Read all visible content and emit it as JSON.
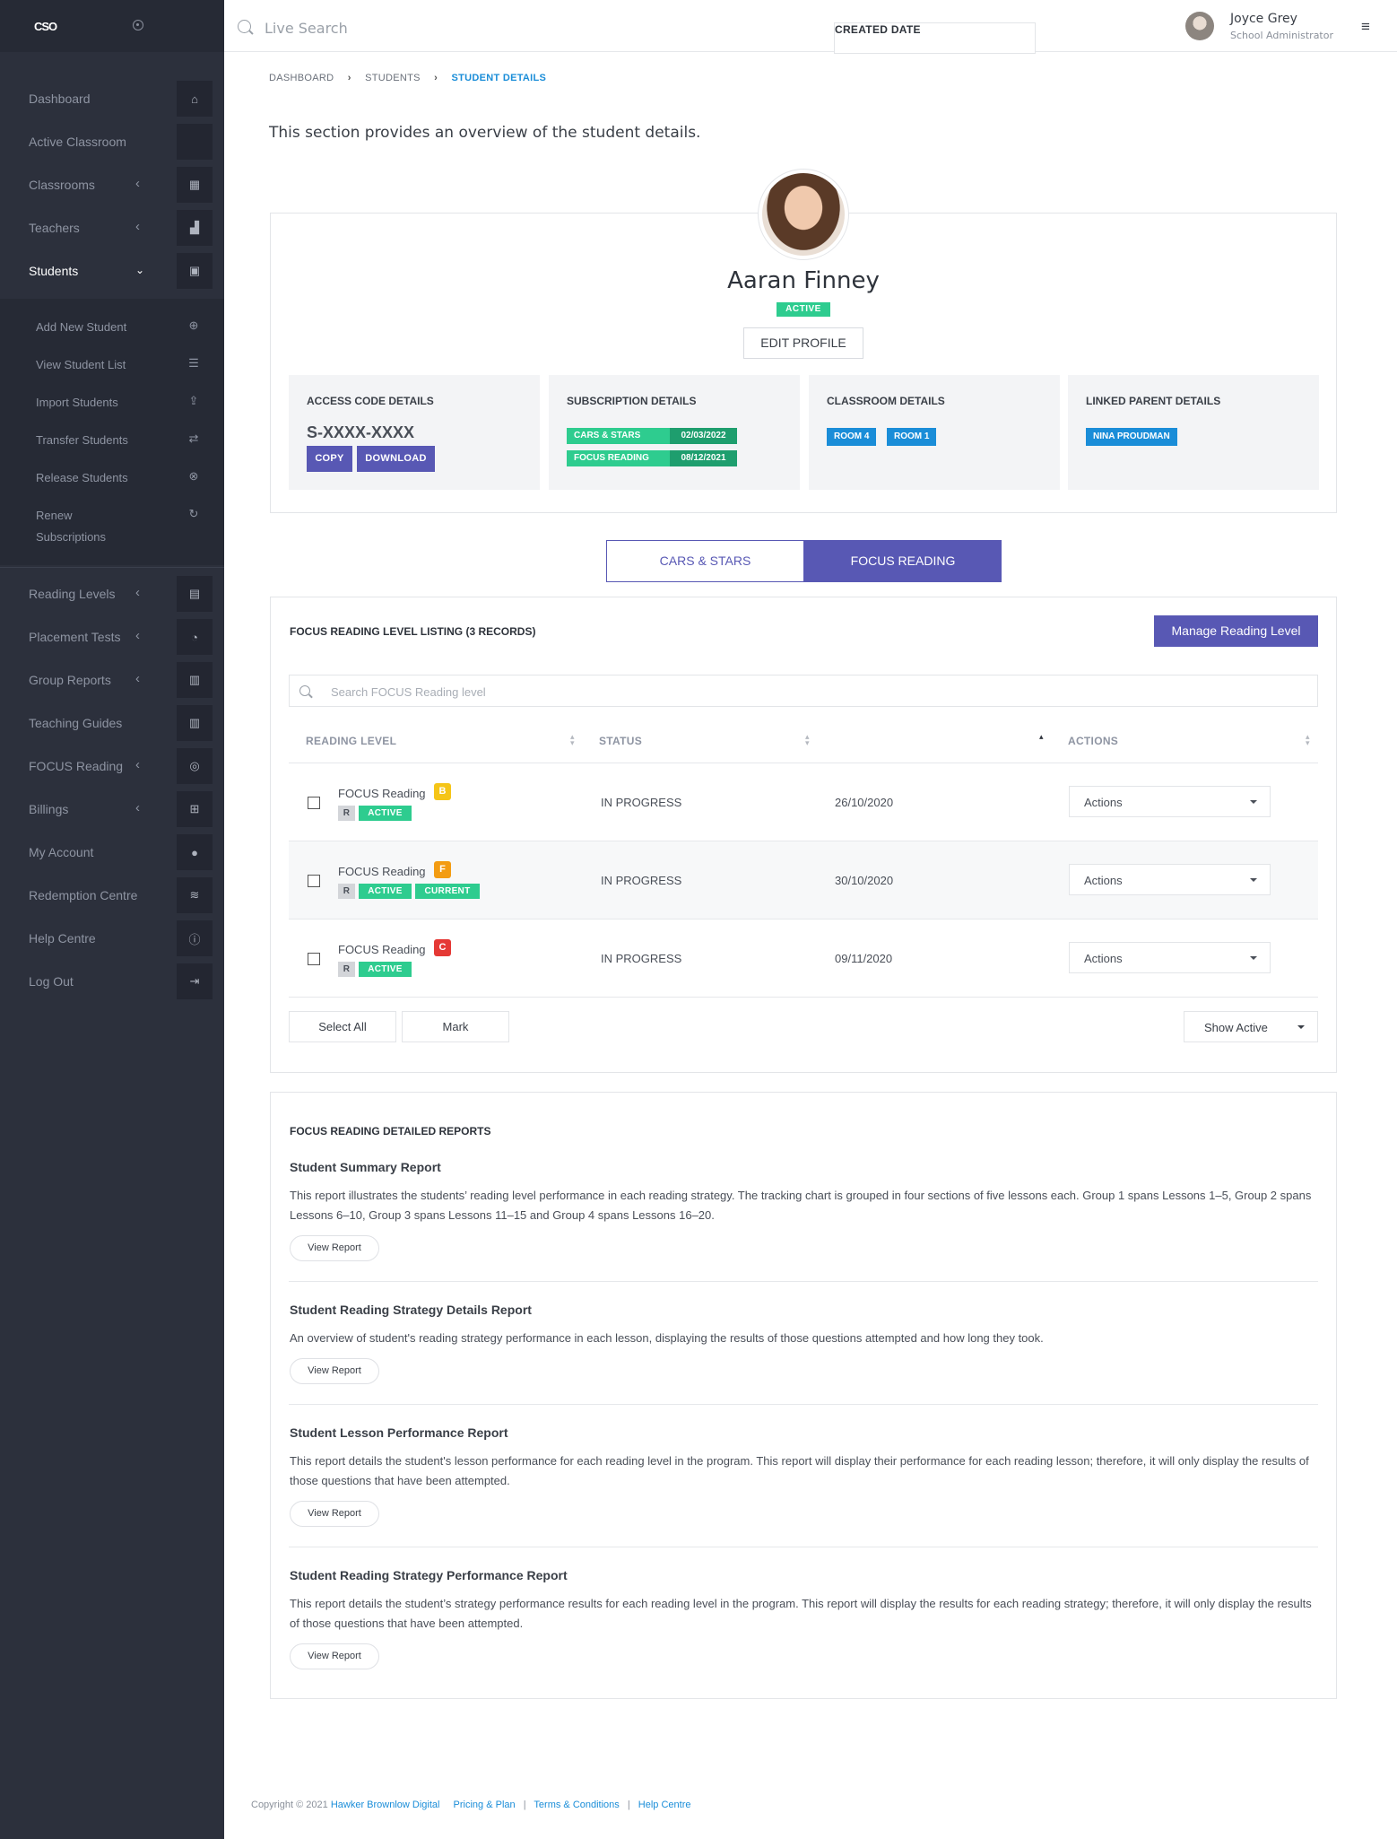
{
  "sidebar": {
    "logo": "CSO",
    "nav": [
      {
        "label": "Dashboard",
        "icon": "home-icon",
        "glyph": "⌂"
      },
      {
        "label": "Active Classroom",
        "icon": "blank-icon",
        "glyph": ""
      },
      {
        "label": "Classrooms",
        "icon": "classroom-icon",
        "glyph": "▦"
      },
      {
        "label": "Teachers",
        "icon": "teacher-icon",
        "glyph": "▟"
      },
      {
        "label": "Students",
        "icon": "student-icon",
        "glyph": "▣"
      }
    ],
    "sub": [
      {
        "label": "Add New Student",
        "icon": "plus-circle-icon",
        "glyph": "⊕"
      },
      {
        "label": "View Student List",
        "icon": "list-icon",
        "glyph": "☰"
      },
      {
        "label": "Import Students",
        "icon": "upload-icon",
        "glyph": "⇪"
      },
      {
        "label": "Transfer Students",
        "icon": "transfer-icon",
        "glyph": "⇄"
      },
      {
        "label": "Release Students",
        "icon": "user-remove-icon",
        "glyph": "⊗"
      },
      {
        "label": "Renew",
        "label2": "Subscriptions",
        "icon": "renew-icon",
        "glyph": "↻"
      }
    ],
    "nav2": [
      {
        "label": "Reading Levels",
        "icon": "book-icon",
        "glyph": "▤"
      },
      {
        "label": "Placement Tests",
        "icon": "gauge-icon",
        "glyph": "◔"
      },
      {
        "label": "Group Reports",
        "icon": "chart-icon",
        "glyph": "▥"
      },
      {
        "label": "Teaching Guides",
        "icon": "library-icon",
        "glyph": "▥"
      },
      {
        "label": "FOCUS Reading",
        "icon": "target-icon",
        "glyph": "◎"
      },
      {
        "label": "Billings",
        "icon": "cart-icon",
        "glyph": "⊞"
      },
      {
        "label": "My Account",
        "icon": "account-icon",
        "glyph": "●"
      },
      {
        "label": "Redemption Centre",
        "icon": "handshake-icon",
        "glyph": "≋"
      },
      {
        "label": "Help Centre",
        "icon": "info-icon",
        "glyph": "ⓘ"
      },
      {
        "label": "Log Out",
        "icon": "logout-icon",
        "glyph": "⇥"
      }
    ]
  },
  "topbar": {
    "search_placeholder": "Live Search",
    "user_name": "Joyce Grey",
    "user_role": "School Administrator"
  },
  "breadcrumb": [
    "DASHBOARD",
    "STUDENTS",
    "STUDENT DETAILS"
  ],
  "intro": "This section provides an overview of the student details.",
  "profile": {
    "name": "Aaran Finney",
    "status": "ACTIVE",
    "edit_label": "EDIT PROFILE"
  },
  "tiles": {
    "access": {
      "title": "ACCESS CODE DETAILS",
      "code": "S-XXXX-XXXX",
      "copy": "COPY",
      "download": "DOWNLOAD"
    },
    "subscription": {
      "title": "SUBSCRIPTION DETAILS",
      "items": [
        {
          "name": "CARS & STARS",
          "date": "02/03/2022"
        },
        {
          "name": "FOCUS READING",
          "date": "08/12/2021"
        }
      ]
    },
    "classroom": {
      "title": "CLASSROOM DETAILS",
      "rooms": [
        "ROOM 4",
        "ROOM 1"
      ]
    },
    "parent": {
      "title": "LINKED PARENT DETAILS",
      "name": "NINA PROUDMAN"
    }
  },
  "tabs": [
    "CARS & STARS",
    "FOCUS READING"
  ],
  "colors": {
    "accent": "#5858b4",
    "green": "#2ecc8f",
    "blue": "#1a8dd8",
    "sidebar": "#2c303c"
  },
  "listing": {
    "title": "FOCUS READING LEVEL LISTING (3 RECORDS)",
    "manage_label": "Manage Reading Level",
    "search_placeholder": "Search FOCUS Reading level",
    "columns": [
      "READING LEVEL",
      "STATUS",
      "CREATED DATE",
      "ACTIONS"
    ],
    "rows": [
      {
        "name": "FOCUS Reading",
        "level": "B",
        "level_color": "#f5c518",
        "r": "R",
        "tags": [
          "ACTIVE"
        ],
        "status": "IN PROGRESS",
        "date": "26/10/2020",
        "action": "Actions"
      },
      {
        "name": "FOCUS Reading",
        "level": "F",
        "level_color": "#f39c12",
        "r": "R",
        "tags": [
          "ACTIVE",
          "CURRENT"
        ],
        "status": "IN PROGRESS",
        "date": "30/10/2020",
        "action": "Actions"
      },
      {
        "name": "FOCUS Reading",
        "level": "C",
        "level_color": "#e53935",
        "r": "R",
        "tags": [
          "ACTIVE"
        ],
        "status": "IN PROGRESS",
        "date": "09/11/2020",
        "action": "Actions"
      }
    ],
    "select_all": "Select All",
    "mark": "Mark",
    "show_filter": "Show Active"
  },
  "reports": {
    "title": "FOCUS READING DETAILED REPORTS",
    "button_label": "View Report",
    "items": [
      {
        "title": "Student Summary Report",
        "desc": "This report illustrates the students’ reading level performance in each reading strategy. The tracking chart is grouped in four sections of five lessons each. Group 1 spans Lessons 1–5, Group 2 spans Lessons 6–10, Group 3 spans Lessons 11–15 and Group 4 spans Lessons 16–20."
      },
      {
        "title": "Student Reading Strategy Details Report",
        "desc": "An overview of student's reading strategy performance in each lesson, displaying the results of those questions attempted and how long they took."
      },
      {
        "title": "Student Lesson Performance Report",
        "desc": "This report details the student's lesson performance for each reading level in the program. This report will display their performance for each reading lesson; therefore, it will only display the results of those questions that have been attempted."
      },
      {
        "title": "Student Reading Strategy Performance Report",
        "desc": "This report details the student’s strategy performance results for each reading level in the program. This report will display the results for each reading strategy; therefore, it will only display the results of those questions that have been attempted."
      }
    ]
  },
  "footer": {
    "copyright": "Copyright © 2021",
    "company": "Hawker Brownlow Digital",
    "links": [
      "Pricing & Plan",
      "Terms & Conditions",
      "Help Centre"
    ]
  }
}
